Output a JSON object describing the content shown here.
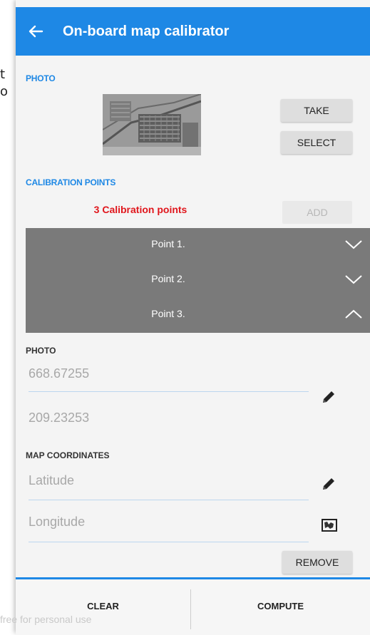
{
  "background_peek": {
    "line1": "t",
    "line2": "o"
  },
  "appbar": {
    "title": "On-board map calibrator",
    "back_icon": "arrow-left-icon",
    "color": "#1e88e5"
  },
  "photo_section": {
    "label": "PHOTO",
    "take_label": "TAKE",
    "select_label": "SELECT"
  },
  "calibration_section": {
    "label": "CALIBRATION POINTS",
    "count_text": "3 Calibration points",
    "add_label": "ADD",
    "points": [
      {
        "label": "Point 1.",
        "expanded": false
      },
      {
        "label": "Point 2.",
        "expanded": false
      },
      {
        "label": "Point 3.",
        "expanded": true
      }
    ]
  },
  "point_detail": {
    "photo_label": "PHOTO",
    "photo_x": "668.67255",
    "photo_y": "209.23253",
    "map_label": "MAP COORDINATES",
    "latitude_placeholder": "Latitude",
    "longitude_placeholder": "Longitude",
    "remove_label": "REMOVE"
  },
  "bottom_bar": {
    "clear_label": "CLEAR",
    "compute_label": "COMPUTE",
    "watermark": "free for personal use"
  },
  "colors": {
    "accent": "#1e88e5",
    "count_red": "#e0161c",
    "panel_gray": "#7a7a7a"
  }
}
